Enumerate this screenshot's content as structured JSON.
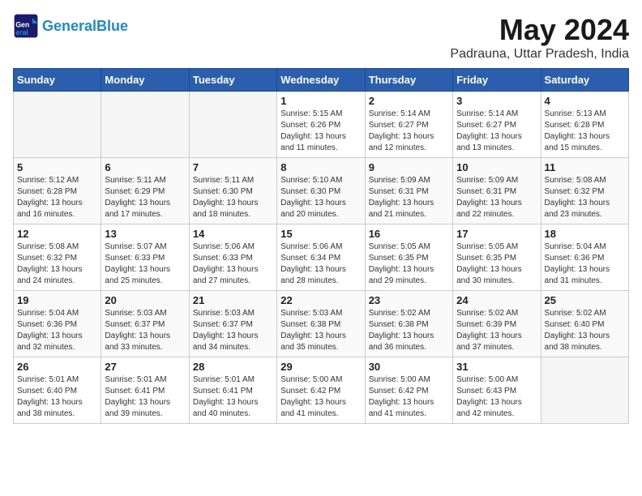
{
  "header": {
    "logo_general": "General",
    "logo_blue": "Blue",
    "month": "May 2024",
    "location": "Padrauna, Uttar Pradesh, India"
  },
  "weekdays": [
    "Sunday",
    "Monday",
    "Tuesday",
    "Wednesday",
    "Thursday",
    "Friday",
    "Saturday"
  ],
  "weeks": [
    [
      {
        "day": "",
        "empty": true
      },
      {
        "day": "",
        "empty": true
      },
      {
        "day": "",
        "empty": true
      },
      {
        "day": "1",
        "sunrise": "5:15 AM",
        "sunset": "6:26 PM",
        "daylight": "13 hours and 11 minutes."
      },
      {
        "day": "2",
        "sunrise": "5:14 AM",
        "sunset": "6:27 PM",
        "daylight": "13 hours and 12 minutes."
      },
      {
        "day": "3",
        "sunrise": "5:14 AM",
        "sunset": "6:27 PM",
        "daylight": "13 hours and 13 minutes."
      },
      {
        "day": "4",
        "sunrise": "5:13 AM",
        "sunset": "6:28 PM",
        "daylight": "13 hours and 15 minutes."
      }
    ],
    [
      {
        "day": "5",
        "sunrise": "5:12 AM",
        "sunset": "6:28 PM",
        "daylight": "13 hours and 16 minutes."
      },
      {
        "day": "6",
        "sunrise": "5:11 AM",
        "sunset": "6:29 PM",
        "daylight": "13 hours and 17 minutes."
      },
      {
        "day": "7",
        "sunrise": "5:11 AM",
        "sunset": "6:30 PM",
        "daylight": "13 hours and 18 minutes."
      },
      {
        "day": "8",
        "sunrise": "5:10 AM",
        "sunset": "6:30 PM",
        "daylight": "13 hours and 20 minutes."
      },
      {
        "day": "9",
        "sunrise": "5:09 AM",
        "sunset": "6:31 PM",
        "daylight": "13 hours and 21 minutes."
      },
      {
        "day": "10",
        "sunrise": "5:09 AM",
        "sunset": "6:31 PM",
        "daylight": "13 hours and 22 minutes."
      },
      {
        "day": "11",
        "sunrise": "5:08 AM",
        "sunset": "6:32 PM",
        "daylight": "13 hours and 23 minutes."
      }
    ],
    [
      {
        "day": "12",
        "sunrise": "5:08 AM",
        "sunset": "6:32 PM",
        "daylight": "13 hours and 24 minutes."
      },
      {
        "day": "13",
        "sunrise": "5:07 AM",
        "sunset": "6:33 PM",
        "daylight": "13 hours and 25 minutes."
      },
      {
        "day": "14",
        "sunrise": "5:06 AM",
        "sunset": "6:33 PM",
        "daylight": "13 hours and 27 minutes."
      },
      {
        "day": "15",
        "sunrise": "5:06 AM",
        "sunset": "6:34 PM",
        "daylight": "13 hours and 28 minutes."
      },
      {
        "day": "16",
        "sunrise": "5:05 AM",
        "sunset": "6:35 PM",
        "daylight": "13 hours and 29 minutes."
      },
      {
        "day": "17",
        "sunrise": "5:05 AM",
        "sunset": "6:35 PM",
        "daylight": "13 hours and 30 minutes."
      },
      {
        "day": "18",
        "sunrise": "5:04 AM",
        "sunset": "6:36 PM",
        "daylight": "13 hours and 31 minutes."
      }
    ],
    [
      {
        "day": "19",
        "sunrise": "5:04 AM",
        "sunset": "6:36 PM",
        "daylight": "13 hours and 32 minutes."
      },
      {
        "day": "20",
        "sunrise": "5:03 AM",
        "sunset": "6:37 PM",
        "daylight": "13 hours and 33 minutes."
      },
      {
        "day": "21",
        "sunrise": "5:03 AM",
        "sunset": "6:37 PM",
        "daylight": "13 hours and 34 minutes."
      },
      {
        "day": "22",
        "sunrise": "5:03 AM",
        "sunset": "6:38 PM",
        "daylight": "13 hours and 35 minutes."
      },
      {
        "day": "23",
        "sunrise": "5:02 AM",
        "sunset": "6:38 PM",
        "daylight": "13 hours and 36 minutes."
      },
      {
        "day": "24",
        "sunrise": "5:02 AM",
        "sunset": "6:39 PM",
        "daylight": "13 hours and 37 minutes."
      },
      {
        "day": "25",
        "sunrise": "5:02 AM",
        "sunset": "6:40 PM",
        "daylight": "13 hours and 38 minutes."
      }
    ],
    [
      {
        "day": "26",
        "sunrise": "5:01 AM",
        "sunset": "6:40 PM",
        "daylight": "13 hours and 38 minutes."
      },
      {
        "day": "27",
        "sunrise": "5:01 AM",
        "sunset": "6:41 PM",
        "daylight": "13 hours and 39 minutes."
      },
      {
        "day": "28",
        "sunrise": "5:01 AM",
        "sunset": "6:41 PM",
        "daylight": "13 hours and 40 minutes."
      },
      {
        "day": "29",
        "sunrise": "5:00 AM",
        "sunset": "6:42 PM",
        "daylight": "13 hours and 41 minutes."
      },
      {
        "day": "30",
        "sunrise": "5:00 AM",
        "sunset": "6:42 PM",
        "daylight": "13 hours and 41 minutes."
      },
      {
        "day": "31",
        "sunrise": "5:00 AM",
        "sunset": "6:43 PM",
        "daylight": "13 hours and 42 minutes."
      },
      {
        "day": "",
        "empty": true
      }
    ]
  ]
}
